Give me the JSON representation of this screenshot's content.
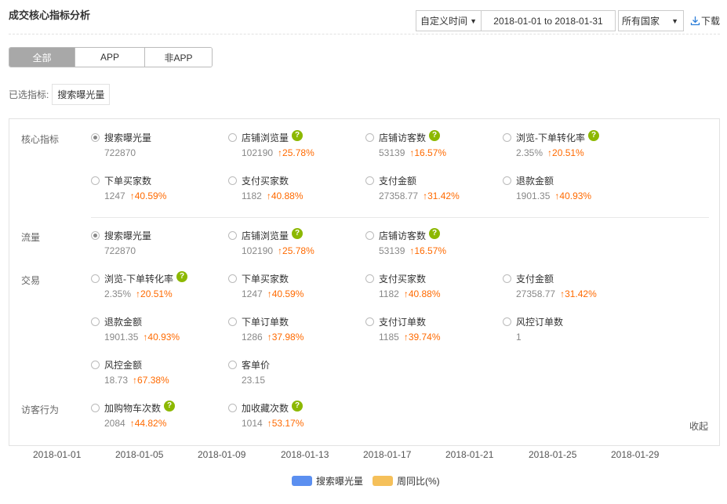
{
  "header": {
    "title": "成交核心指标分析",
    "date_type": "自定义时间",
    "date_range": "2018-01-01 to 2018-01-31",
    "country": "所有国家",
    "download": "下载"
  },
  "tabs": [
    "全部",
    "APP",
    "非APP"
  ],
  "selected": {
    "label": "已选指标:",
    "chip": "搜索曝光量"
  },
  "groups": {
    "core": "核心指标",
    "traffic": "流量",
    "trade": "交易",
    "visitor": "访客行为"
  },
  "metrics": {
    "core": [
      {
        "name": "搜索曝光量",
        "value": "722870",
        "change": "",
        "help": false,
        "checked": true
      },
      {
        "name": "店铺浏览量",
        "value": "102190",
        "change": "↑25.78%",
        "help": true,
        "checked": false
      },
      {
        "name": "店铺访客数",
        "value": "53139",
        "change": "↑16.57%",
        "help": true,
        "checked": false
      },
      {
        "name": "浏览-下单转化率",
        "value": "2.35%",
        "change": "↑20.51%",
        "help": true,
        "checked": false
      },
      {
        "name": "下单买家数",
        "value": "1247",
        "change": "↑40.59%",
        "help": false,
        "checked": false
      },
      {
        "name": "支付买家数",
        "value": "1182",
        "change": "↑40.88%",
        "help": false,
        "checked": false
      },
      {
        "name": "支付金额",
        "value": "27358.77",
        "change": "↑31.42%",
        "help": false,
        "checked": false
      },
      {
        "name": "退款金额",
        "value": "1901.35",
        "change": "↑40.93%",
        "help": false,
        "checked": false
      }
    ],
    "traffic": [
      {
        "name": "搜索曝光量",
        "value": "722870",
        "change": "",
        "help": false,
        "checked": true
      },
      {
        "name": "店铺浏览量",
        "value": "102190",
        "change": "↑25.78%",
        "help": true,
        "checked": false
      },
      {
        "name": "店铺访客数",
        "value": "53139",
        "change": "↑16.57%",
        "help": true,
        "checked": false
      }
    ],
    "trade": [
      {
        "name": "浏览-下单转化率",
        "value": "2.35%",
        "change": "↑20.51%",
        "help": true,
        "checked": false
      },
      {
        "name": "下单买家数",
        "value": "1247",
        "change": "↑40.59%",
        "help": false,
        "checked": false
      },
      {
        "name": "支付买家数",
        "value": "1182",
        "change": "↑40.88%",
        "help": false,
        "checked": false
      },
      {
        "name": "支付金额",
        "value": "27358.77",
        "change": "↑31.42%",
        "help": false,
        "checked": false
      },
      {
        "name": "退款金额",
        "value": "1901.35",
        "change": "↑40.93%",
        "help": false,
        "checked": false
      },
      {
        "name": "下单订单数",
        "value": "1286",
        "change": "↑37.98%",
        "help": false,
        "checked": false
      },
      {
        "name": "支付订单数",
        "value": "1185",
        "change": "↑39.74%",
        "help": false,
        "checked": false
      },
      {
        "name": "风控订单数",
        "value": "1",
        "change": "",
        "help": false,
        "checked": false
      },
      {
        "name": "风控金额",
        "value": "18.73",
        "change": "↑67.38%",
        "help": false,
        "checked": false
      },
      {
        "name": "客单价",
        "value": "23.15",
        "change": "",
        "help": false,
        "checked": false
      }
    ],
    "visitor": [
      {
        "name": "加购物车次数",
        "value": "2084",
        "change": "↑44.82%",
        "help": true,
        "checked": false
      },
      {
        "name": "加收藏次数",
        "value": "1014",
        "change": "↑53.17%",
        "help": true,
        "checked": false
      }
    ]
  },
  "collapse": "收起",
  "axis_ticks": [
    "2018-01-01",
    "2018-01-05",
    "2018-01-09",
    "2018-01-13",
    "2018-01-17",
    "2018-01-21",
    "2018-01-25",
    "2018-01-29"
  ],
  "legend": [
    {
      "name": "搜索曝光量",
      "color": "#5b8ff0"
    },
    {
      "name": "周同比(%)",
      "color": "#f5c05a"
    }
  ],
  "help_glyph": "?"
}
